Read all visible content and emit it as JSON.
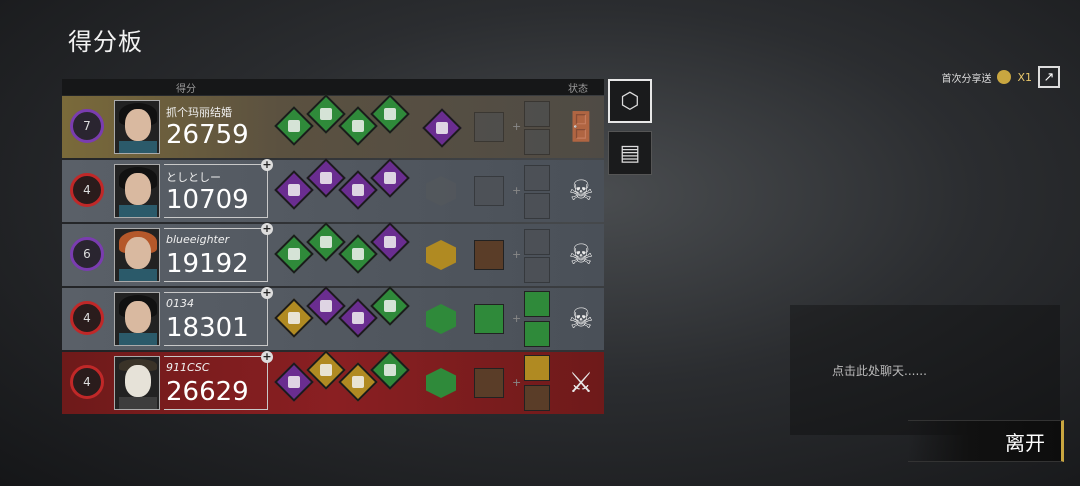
{
  "title": "得分板",
  "header": {
    "score_label": "得分",
    "status_label": "状态"
  },
  "players": [
    {
      "rank": "7",
      "rank_color": "purple",
      "name": "抓个玛丽结婚",
      "score": "26759",
      "status_icon": "exit-door-icon",
      "status_glyph": "🚪"
    },
    {
      "rank": "4",
      "rank_color": "red",
      "name": "としとしー",
      "score": "10709",
      "status_icon": "skull-icon",
      "status_glyph": "☠"
    },
    {
      "rank": "6",
      "rank_color": "purple",
      "name": "blueeighter",
      "score": "19192",
      "status_icon": "skull-icon",
      "status_glyph": "☠"
    },
    {
      "rank": "4",
      "rank_color": "red",
      "name": "0134",
      "score": "18301",
      "status_icon": "skull-icon",
      "status_glyph": "☠"
    },
    {
      "rank": "4",
      "rank_color": "red",
      "name": "911CSC",
      "score": "26629",
      "status_icon": "killer-icon",
      "status_glyph": "⚔"
    }
  ],
  "side_buttons": [
    {
      "icon": "emblem-icon",
      "glyph": "⬡"
    },
    {
      "icon": "details-icon",
      "glyph": "▤"
    }
  ],
  "share": {
    "label": "首次分享送",
    "count": "X1",
    "icon": "share-icon",
    "glyph": "↗"
  },
  "chat_placeholder": "点击此处聊天......",
  "leave_button": "离开",
  "colors": {
    "rare_purple": "#6a2d90",
    "uncommon_green": "#2f8a3a",
    "killer_red": "#8a1f22",
    "gold": "#c9a640"
  }
}
